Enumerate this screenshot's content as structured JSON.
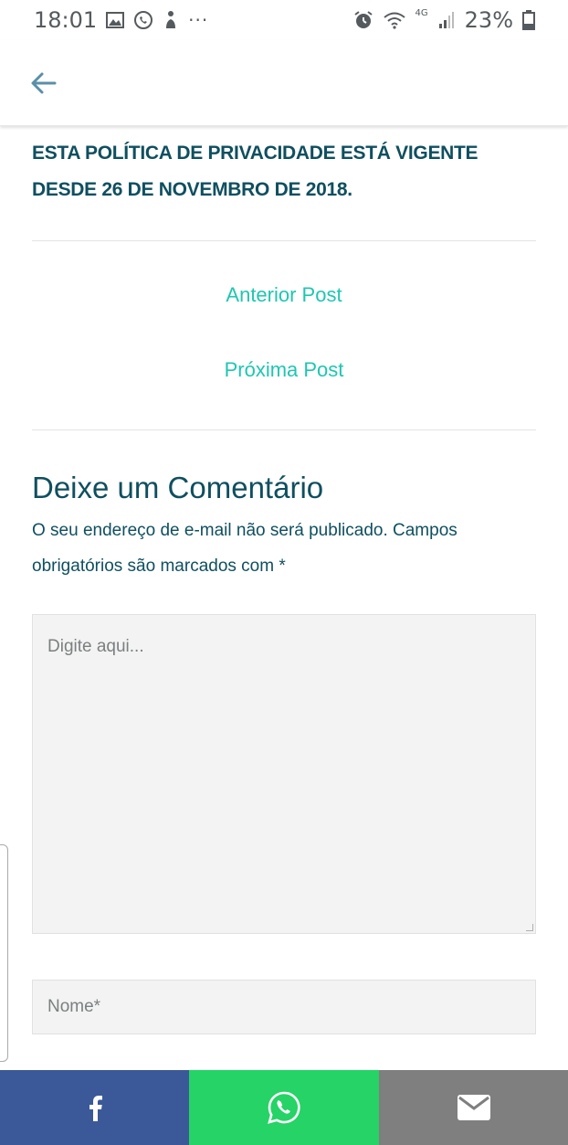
{
  "status_bar": {
    "time": "18:01",
    "network_type": "4G",
    "battery": "23%",
    "icons": [
      "gallery-icon",
      "whatsapp-icon",
      "app-icon",
      "more-icon",
      "alarm-icon",
      "wifi-icon",
      "signal-icon",
      "battery-icon"
    ]
  },
  "header": {
    "back_icon": "arrow-left-icon",
    "accent": "#5a8fa8"
  },
  "content": {
    "policy_notice": "ESTA POLÍTICA DE PRIVACIDADE ESTÁ VIGENTE DESDE 26 DE NOVEMBRO DE 2018.",
    "prev_post": "Anterior Post",
    "next_post": "Próxima Post",
    "comment_title": "Deixe um Comentário",
    "comment_note": "O seu endereço de e-mail não será publicado. Campos obrigatórios são marcados com *",
    "comment_placeholder": "Digite aqui...",
    "name_placeholder": "Nome*"
  },
  "share_bar": {
    "buttons": [
      {
        "name": "facebook",
        "icon": "facebook-icon",
        "color": "#3b5998"
      },
      {
        "name": "whatsapp",
        "icon": "whatsapp-icon",
        "color": "#25d366"
      },
      {
        "name": "email",
        "icon": "mail-icon",
        "color": "#7f7f7f"
      }
    ]
  },
  "colors": {
    "heading": "#0f4f5f",
    "link": "#1fc6b0",
    "field_bg": "#f3f3f3"
  }
}
